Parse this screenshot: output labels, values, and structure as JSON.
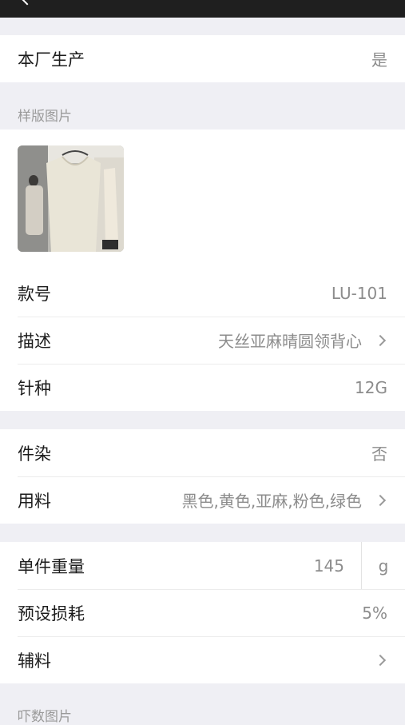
{
  "section1": {
    "label": "本厂生产",
    "value": "是"
  },
  "sample_images_title": "样版图片",
  "section2": {
    "style_no_label": "款号",
    "style_no_value": "LU-101",
    "desc_label": "描述",
    "desc_value": "天丝亚麻晴圆领背心",
    "gauge_label": "针种",
    "gauge_value": "12G"
  },
  "section3": {
    "dye_label": "件染",
    "dye_value": "否",
    "material_label": "用料",
    "material_value": "黑色,黄色,亚麻,粉色,绿色"
  },
  "section4": {
    "weight_label": "单件重量",
    "weight_value": "145",
    "weight_unit": "g",
    "loss_label": "预设损耗",
    "loss_value": "5%",
    "accessory_label": "辅料"
  },
  "size_images_title": "吓数图片"
}
